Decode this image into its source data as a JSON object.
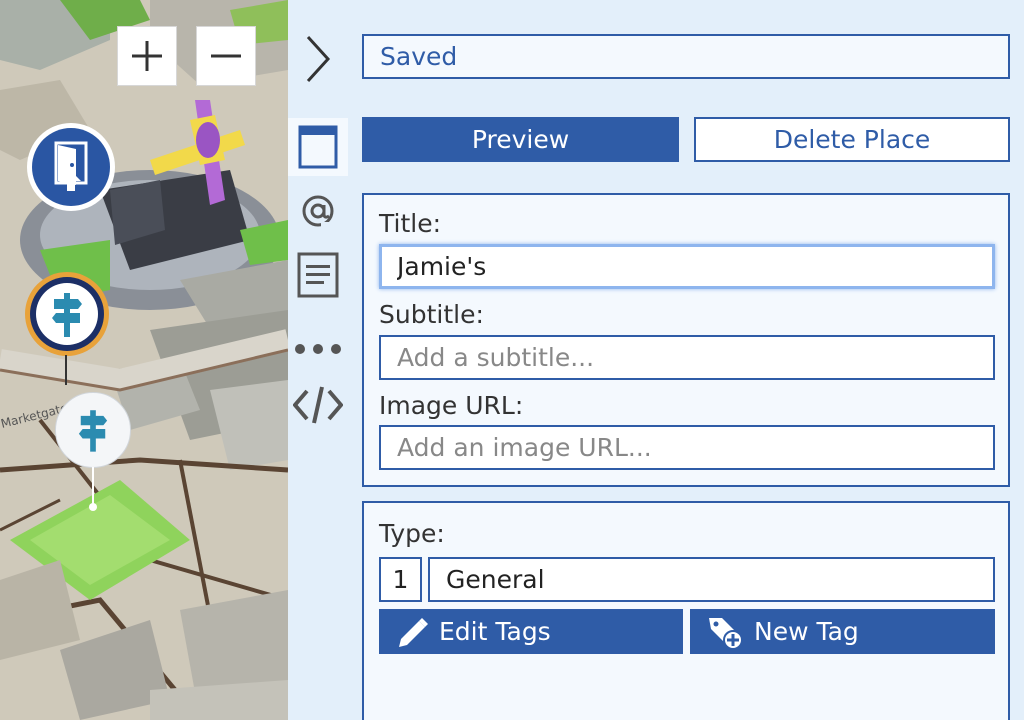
{
  "map": {
    "zoom_in_icon": "plus-icon",
    "zoom_out_icon": "minus-icon",
    "street_label": "Marketgate",
    "markers": [
      "entrance-marker",
      "signpost-marker-selected",
      "signpost-marker"
    ]
  },
  "rail": {
    "collapse_icon": "chevron-right-icon",
    "items": [
      "window-icon",
      "at-sign-icon",
      "document-lines-icon",
      "more-dots-icon",
      "code-icon"
    ]
  },
  "panel": {
    "status": "Saved",
    "preview_label": "Preview",
    "delete_label": "Delete Place",
    "title_label": "Title:",
    "title_value": "Jamie's",
    "subtitle_label": "Subtitle:",
    "subtitle_placeholder": "Add a subtitle...",
    "image_url_label": "Image URL:",
    "image_url_placeholder": "Add an image URL...",
    "type_label": "Type:",
    "type_number": "1",
    "type_value": "General",
    "edit_tags_label": "Edit Tags",
    "new_tag_label": "New Tag"
  },
  "colors": {
    "accent": "#2f5ca7",
    "panel_bg": "#e3effa",
    "card_bg": "#f4f9fe",
    "focus_ring": "#8eb5ee"
  }
}
